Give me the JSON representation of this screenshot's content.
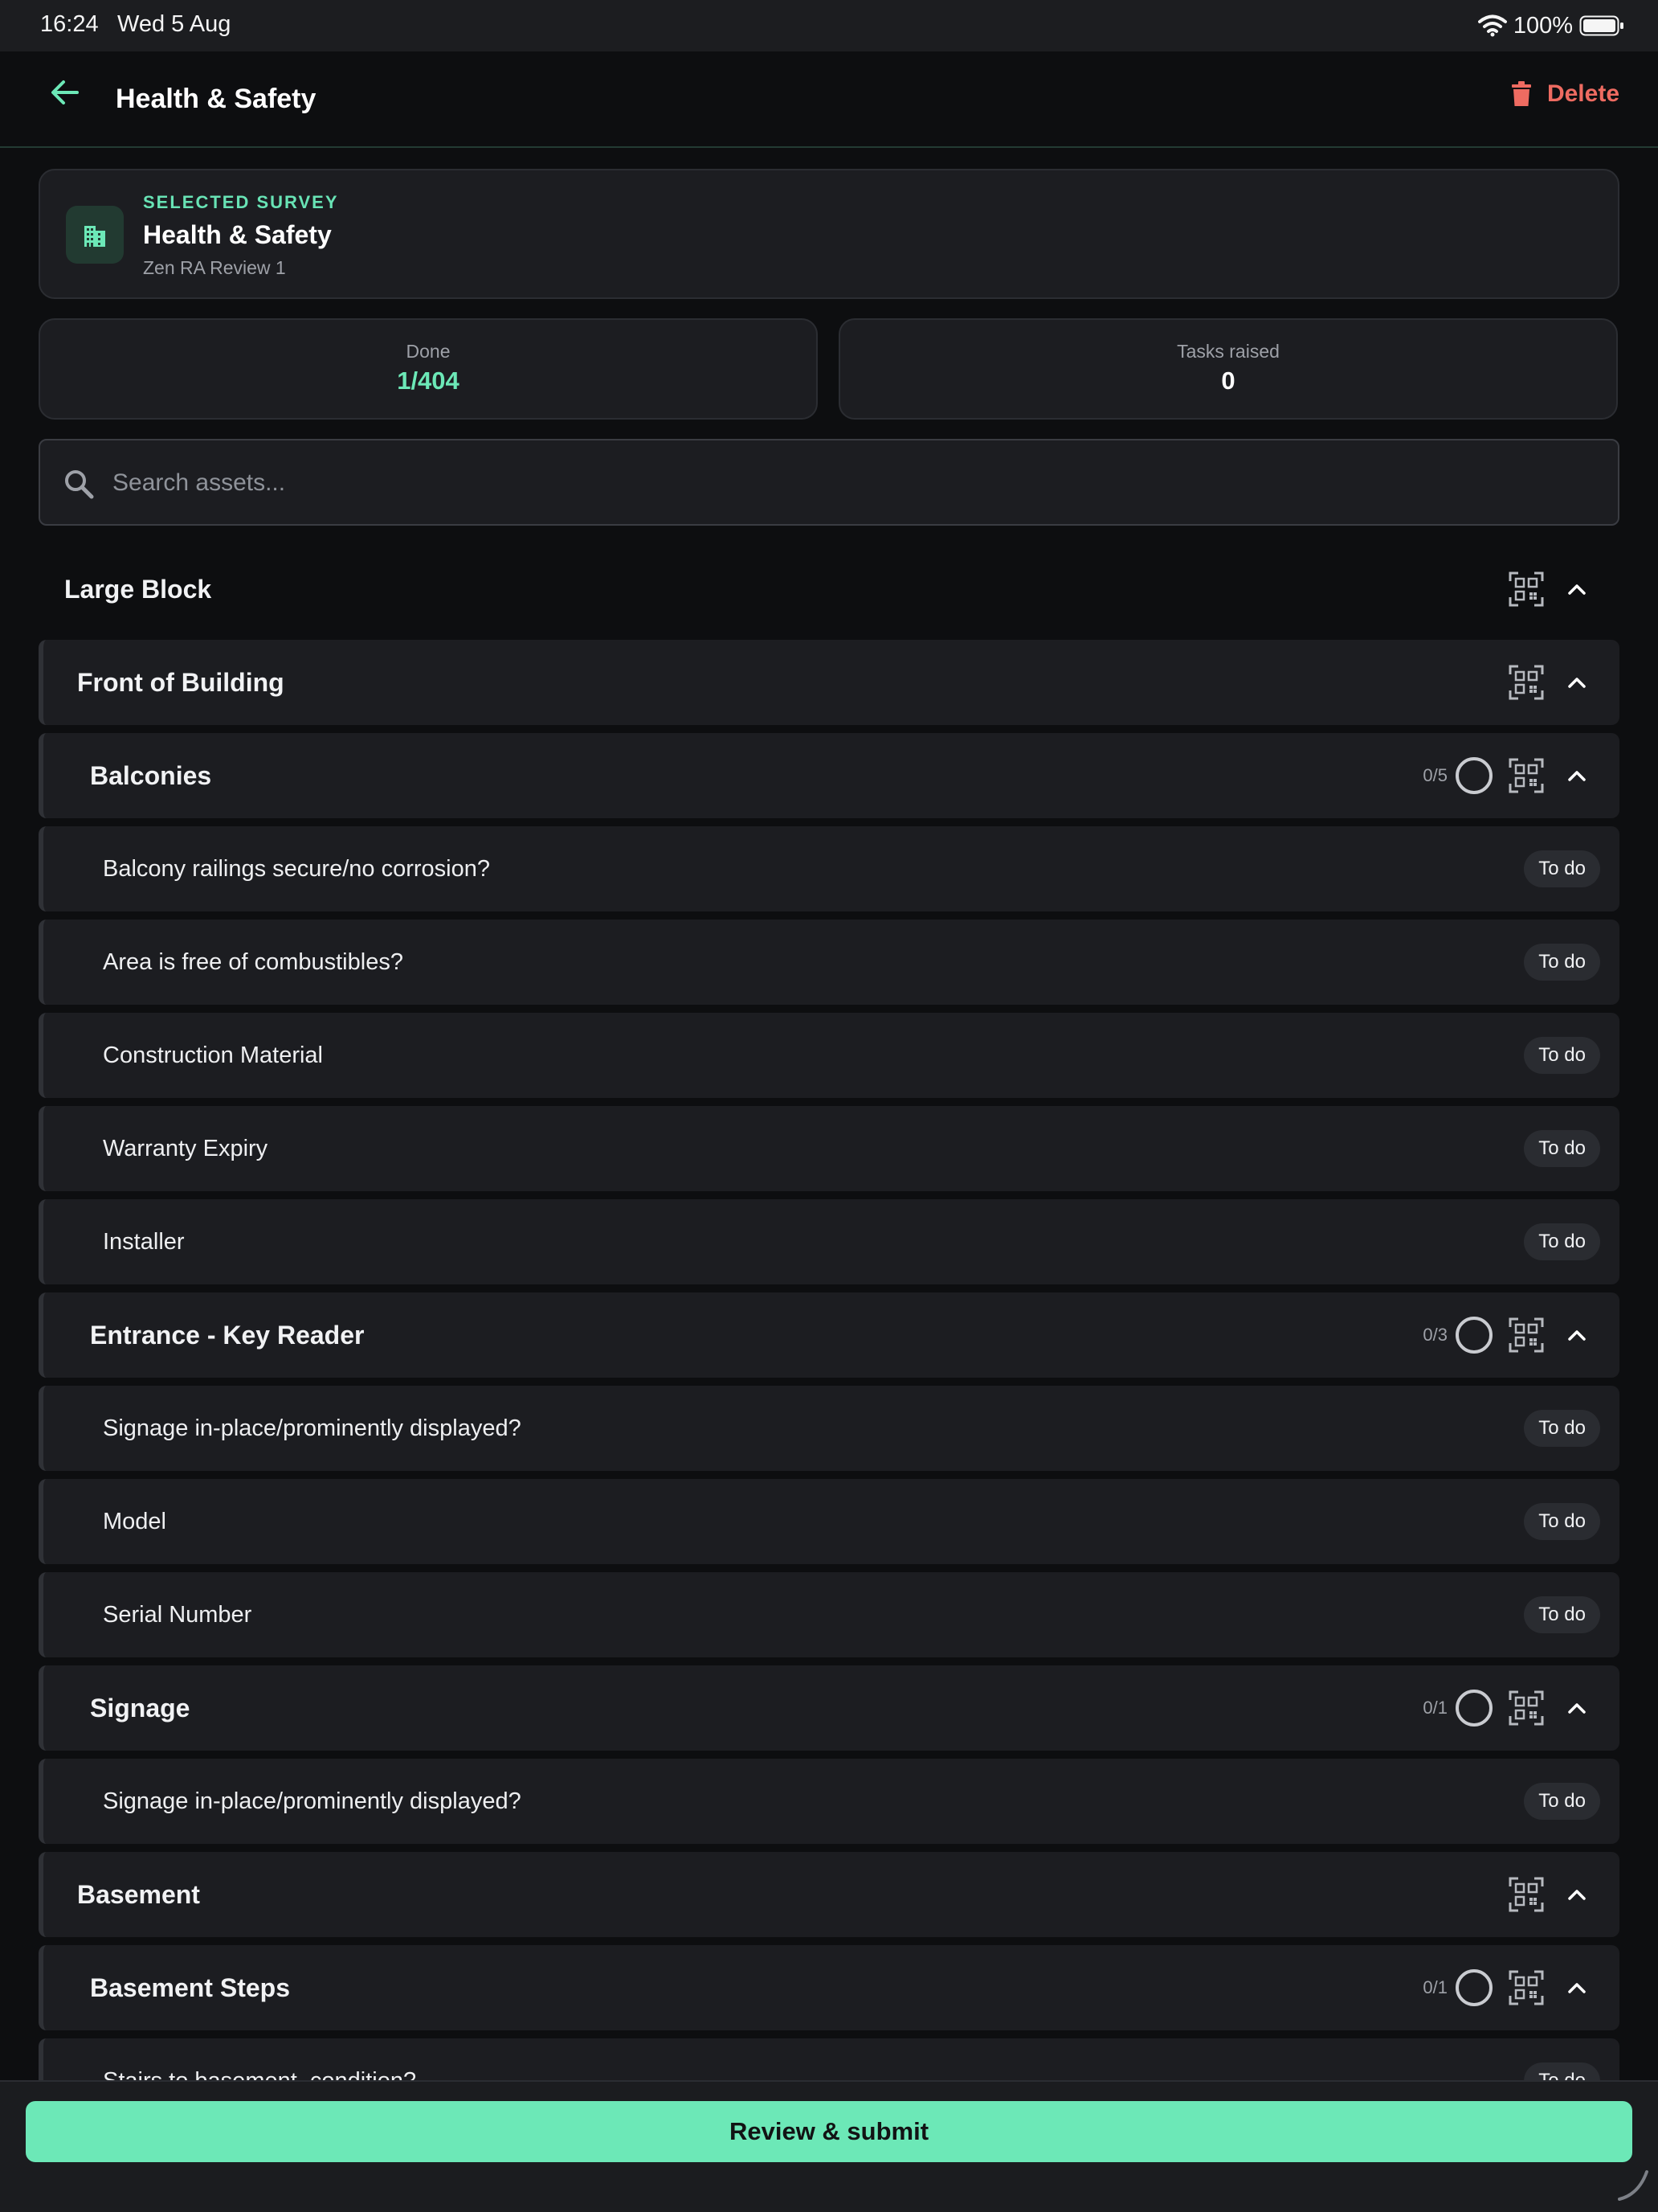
{
  "status_bar": {
    "time": "16:24",
    "date": "Wed 5 Aug",
    "battery": "100%"
  },
  "header": {
    "title": "Health & Safety",
    "delete_label": "Delete"
  },
  "survey": {
    "eyebrow": "SELECTED SURVEY",
    "name": "Health & Safety",
    "subtitle": "Zen RA Review 1"
  },
  "stats": {
    "done": {
      "label": "Done",
      "value": "1/404"
    },
    "tasks": {
      "label": "Tasks raised",
      "value": "0"
    }
  },
  "search": {
    "placeholder": "Search assets...",
    "value": ""
  },
  "colors": {
    "accent": "#6ce8b7",
    "danger": "#ee6b61",
    "card": "#1c1d21",
    "background": "#0d0e10"
  },
  "icons": [
    "arrow-left-icon",
    "trash-icon",
    "building-icon",
    "search-icon",
    "qr-scan-icon",
    "chevron-up-icon",
    "progress-ring-icon",
    "wifi-icon",
    "battery-icon"
  ],
  "todo_label": "To do",
  "list": [
    {
      "type": "group",
      "level": 0,
      "label": "Large Block"
    },
    {
      "type": "group",
      "level": 1,
      "label": "Front of Building"
    },
    {
      "type": "group",
      "level": 2,
      "label": "Balconies",
      "count": "0/5",
      "progress": 0
    },
    {
      "type": "item",
      "label": "Balcony railings secure/no corrosion?",
      "status": "To do"
    },
    {
      "type": "item",
      "label": "Area is free of combustibles?",
      "status": "To do"
    },
    {
      "type": "item",
      "label": "Construction Material",
      "status": "To do"
    },
    {
      "type": "item",
      "label": "Warranty Expiry",
      "status": "To do"
    },
    {
      "type": "item",
      "label": "Installer",
      "status": "To do"
    },
    {
      "type": "group",
      "level": 2,
      "label": "Entrance - Key Reader",
      "count": "0/3",
      "progress": 0
    },
    {
      "type": "item",
      "label": "Signage in-place/prominently displayed?",
      "status": "To do"
    },
    {
      "type": "item",
      "label": "Model",
      "status": "To do"
    },
    {
      "type": "item",
      "label": "Serial Number",
      "status": "To do"
    },
    {
      "type": "group",
      "level": 2,
      "label": "Signage",
      "count": "0/1",
      "progress": 0
    },
    {
      "type": "item",
      "label": "Signage in-place/prominently displayed?",
      "status": "To do"
    },
    {
      "type": "group",
      "level": 1,
      "label": "Basement"
    },
    {
      "type": "group",
      "level": 2,
      "label": "Basement Steps",
      "count": "0/1",
      "progress": 0
    },
    {
      "type": "item",
      "label": "Stairs to basement, condition?",
      "status": "To do"
    }
  ],
  "footer": {
    "submit_label": "Review & submit"
  }
}
